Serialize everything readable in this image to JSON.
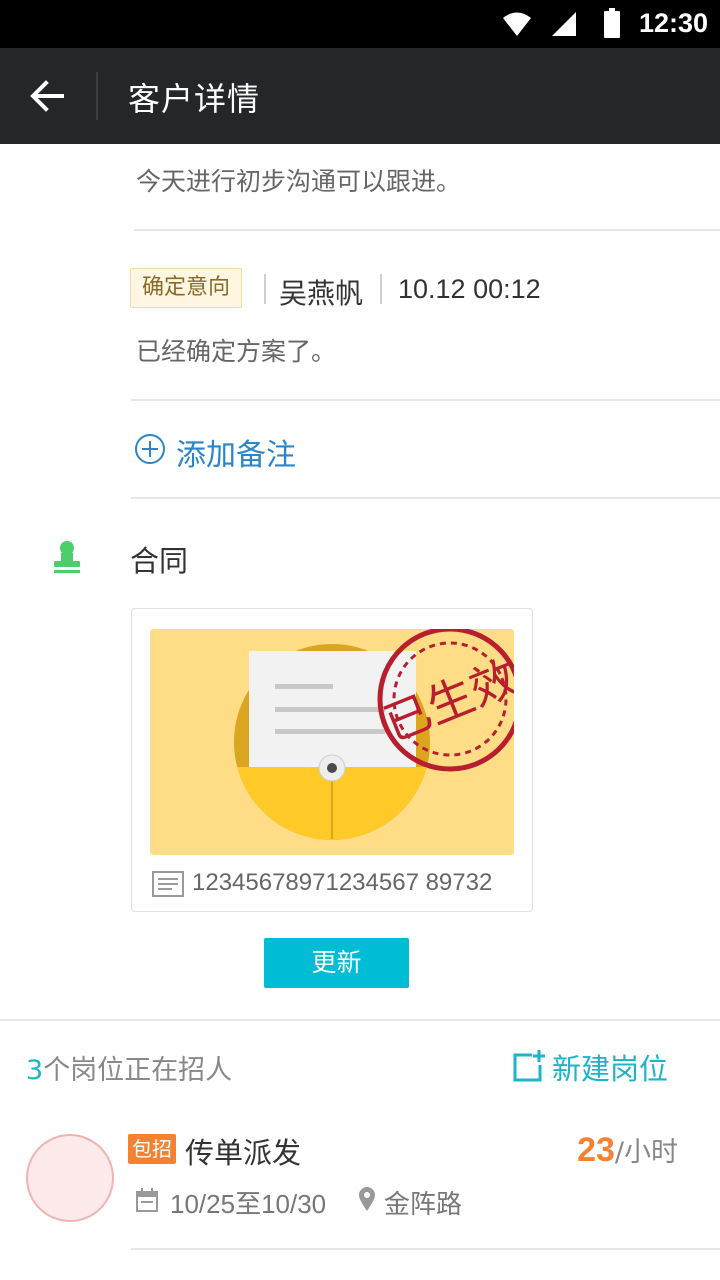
{
  "status_bar": {
    "time": "12:30"
  },
  "toolbar": {
    "title": "客户详情"
  },
  "notes": [
    {
      "text": "今天进行初步沟通可以跟进。"
    },
    {
      "tag": "确定意向",
      "author": "吴燕帆",
      "time": "10.12 00:12",
      "text": "已经确定方案了。"
    }
  ],
  "add_note": {
    "label": "添加备注"
  },
  "contract": {
    "title": "合同",
    "number": "12345678971234567 89732",
    "stamp_text": "已生效",
    "update_label": "更新"
  },
  "jobs": {
    "count": "3",
    "count_suffix": "个岗位正在招人",
    "new_label": "新建岗位",
    "items": [
      {
        "badge": "包招",
        "title": "传单派发",
        "salary": "23",
        "unit": "/小时",
        "dates": "10/25至10/30",
        "location": "金阵路"
      }
    ]
  },
  "colors": {
    "toolbar": "#23272a",
    "accent_blue": "#2b86c8",
    "teal": "#1eb4c8",
    "button": "#00bcd4",
    "orange": "#f58232",
    "green_icon": "#4cce6a"
  }
}
